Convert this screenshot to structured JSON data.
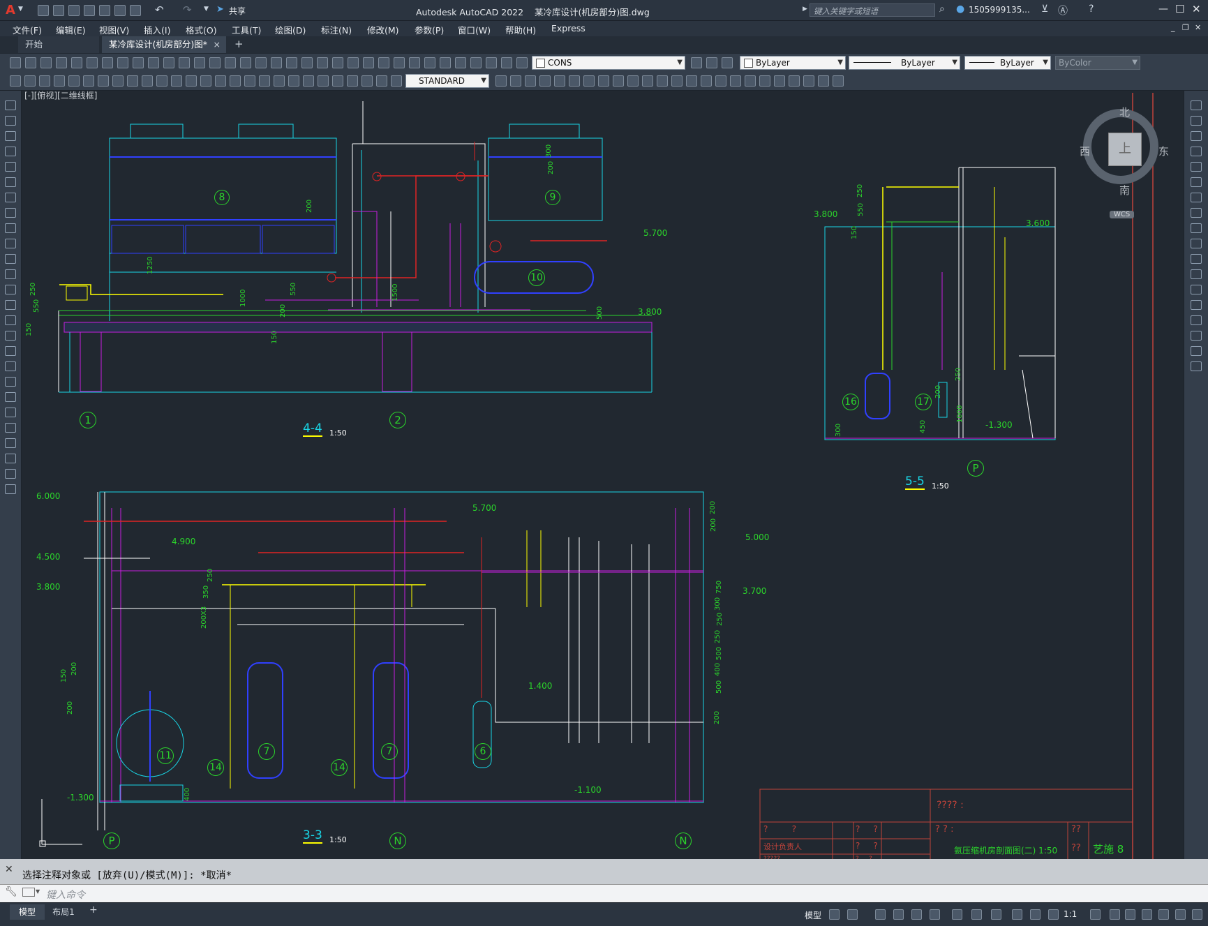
{
  "app": {
    "logo": "A",
    "title": "Autodesk AutoCAD 2022    某冷库设计(机房部分)图.dwg",
    "share_label": "共享",
    "search_placeholder": "键入关键字或短语",
    "user": "1505999135...",
    "accent_color": "#e23a2e"
  },
  "menu": [
    "文件(F)",
    "编辑(E)",
    "视图(V)",
    "插入(I)",
    "格式(O)",
    "工具(T)",
    "绘图(D)",
    "标注(N)",
    "修改(M)",
    "参数(P)",
    "窗口(W)",
    "帮助(H)",
    "Express"
  ],
  "tabs": {
    "start": "开始",
    "active": "某冷库设计(机房部分)图*",
    "close": "×",
    "add": "+"
  },
  "toolbar": {
    "layer": "CONS",
    "color": "ByLayer",
    "linetype": "ByLayer",
    "lineweight": "ByLayer",
    "plotstyle": "ByColor",
    "textstyle": "STANDARD"
  },
  "viewport": {
    "label": "[-][俯视][二维线框]",
    "viewcube": {
      "north": "北",
      "south": "南",
      "east": "东",
      "west": "西",
      "top": "上",
      "wcs": "WCS"
    }
  },
  "drawing": {
    "sec44": {
      "title": "4-4",
      "scale": "1:50",
      "axis1": "1",
      "axis2": "2",
      "equip": [
        "8",
        "9",
        "10"
      ],
      "elev": [
        "5.700",
        "3.800"
      ],
      "dims": [
        "250",
        "550",
        "150",
        "1000",
        "550",
        "200",
        "1500",
        "500",
        "200",
        "200",
        "300",
        "150",
        "1250"
      ]
    },
    "sec55": {
      "title": "5-5",
      "scale": "1:50",
      "axis": "P",
      "equip": [
        "16",
        "17"
      ],
      "elev": [
        "3.800",
        "3.600",
        "-1.300"
      ],
      "dims": [
        "250",
        "550",
        "150",
        "250",
        "200",
        "1000",
        "300",
        "450"
      ]
    },
    "sec33": {
      "title": "3-3",
      "scale": "1:50",
      "axes": [
        "P",
        "N",
        "N"
      ],
      "equip": [
        "11",
        "7",
        "7",
        "6",
        "14",
        "14"
      ],
      "elev": [
        "6.000",
        "5.700",
        "4.900",
        "4.500",
        "3.800",
        "5.000",
        "3.700",
        "1.400",
        "-1.100",
        "-1.300"
      ],
      "dims": [
        "250",
        "350",
        "200X3",
        "150",
        "200",
        "200",
        "200",
        "750",
        "300",
        "250",
        "250",
        "500",
        "400",
        "500",
        "200",
        "400",
        "200"
      ]
    },
    "title_block": {
      "field1": "???? :",
      "row1": "?         ?",
      "row2": "设计负责人",
      "row3": "?????",
      "q1": "?     ?",
      "q2": "?     ?",
      "q3": "?     ?",
      "q4": "? ? :",
      "drawing_name": "氨压缩机房剖面图(二) 1:50",
      "q5": "??",
      "code_left": "??",
      "code": "艺施 8"
    }
  },
  "command": {
    "history": "选择注释对象或 [放弃(U)/模式(M)]: *取消*",
    "placeholder": "键入命令"
  },
  "status": {
    "layout_tabs": [
      "模型",
      "布局1"
    ],
    "add_layout": "+",
    "model": "模型",
    "scale": "1:1"
  }
}
